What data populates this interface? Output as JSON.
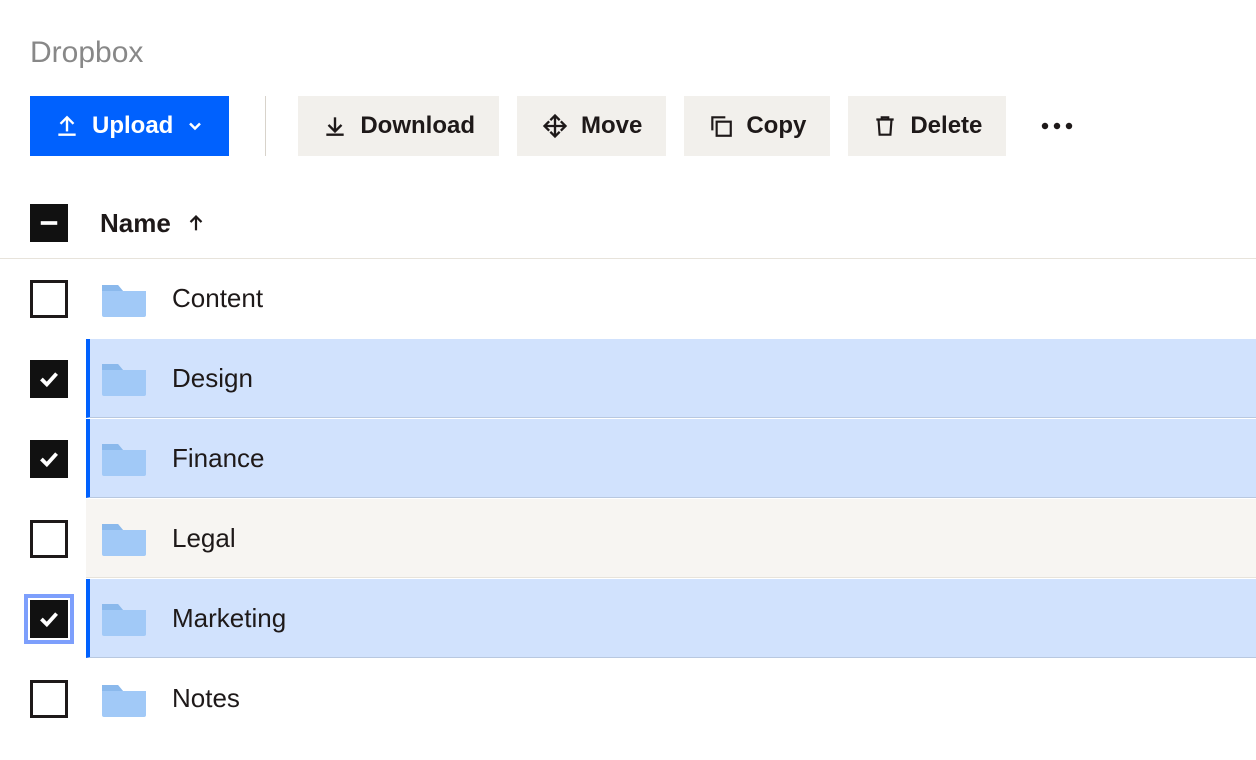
{
  "breadcrumb": "Dropbox",
  "toolbar": {
    "upload_label": "Upload",
    "download_label": "Download",
    "move_label": "Move",
    "copy_label": "Copy",
    "delete_label": "Delete"
  },
  "columns": {
    "name": "Name",
    "sort": "asc"
  },
  "header_checkbox_state": "indeterminate",
  "items": [
    {
      "name": "Content",
      "type": "folder",
      "selected": false,
      "hover": false,
      "focused": false
    },
    {
      "name": "Design",
      "type": "folder",
      "selected": true,
      "hover": false,
      "focused": false
    },
    {
      "name": "Finance",
      "type": "folder",
      "selected": true,
      "hover": false,
      "focused": false
    },
    {
      "name": "Legal",
      "type": "folder",
      "selected": false,
      "hover": true,
      "focused": false
    },
    {
      "name": "Marketing",
      "type": "folder",
      "selected": true,
      "hover": false,
      "focused": true
    },
    {
      "name": "Notes",
      "type": "folder",
      "selected": false,
      "hover": false,
      "focused": false
    }
  ],
  "colors": {
    "primary": "#0061fe",
    "secondary_bg": "#f2f0ec",
    "selected_bg": "#d1e2fd",
    "folder_fill": "#a1c9f7",
    "text": "#1e1919",
    "muted": "#888888"
  }
}
